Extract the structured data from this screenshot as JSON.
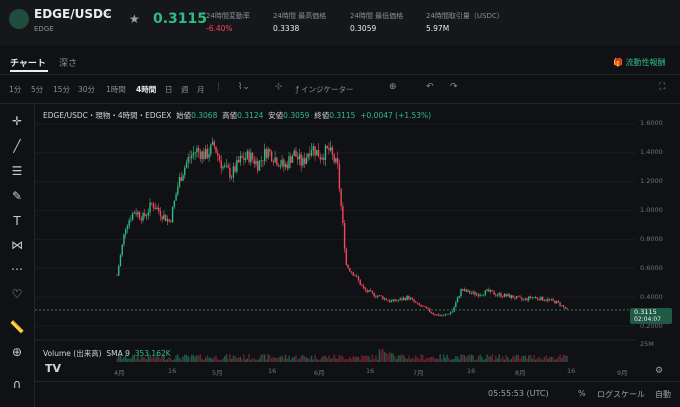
{
  "header": {
    "pair": "EDGE/USDC",
    "sub": "EDGE",
    "price": "0.3115",
    "stats": [
      {
        "label": "24時間変動率",
        "value": "-6.40%"
      },
      {
        "label": "24時間 最高価格",
        "value": "0.3338"
      },
      {
        "label": "24時間 最低価格",
        "value": "0.3059"
      },
      {
        "label": "24時間取引量（USDC）",
        "value": "5.97M"
      }
    ]
  },
  "tabs": {
    "chart": "チャート",
    "depth": "深さ",
    "liquidity": "流動性報酬"
  },
  "toolbar": {
    "timeframes": [
      "1分",
      "5分",
      "15分",
      "30分",
      "1時間",
      "4時間",
      "日",
      "週",
      "月"
    ],
    "active_timeframe": "4時間",
    "indicators": "インジケーター"
  },
  "legend": {
    "title": "EDGE/USDC・現物・4時間・EDGEX",
    "open_label": "始値",
    "open": "0.3068",
    "high_label": "高値",
    "high": "0.3124",
    "low_label": "安値",
    "low": "0.3059",
    "close_label": "終値",
    "close": "0.3115",
    "change": "+0.0047 (+1.53%)"
  },
  "volume_legend": {
    "label": "Volume (出来高)",
    "sma": "SMA 9",
    "value": "353.162K"
  },
  "price_tag": {
    "price": "0.3115",
    "countdown": "02:04:07"
  },
  "bottom": {
    "time": "05:55:53 (UTC)",
    "pct": "%",
    "log": "ログスケール",
    "auto": "自動"
  },
  "colors": {
    "up": "#2ebd85",
    "down": "#f6465d",
    "bg": "#101114"
  },
  "chart_data": {
    "type": "candlestick",
    "y_ticks": [
      "1.6000",
      "1.4000",
      "1.2000",
      "1.0000",
      "0.8000",
      "0.6000",
      "0.4000",
      "0.2000"
    ],
    "volume_tick": "25M",
    "x_ticks": [
      "4月",
      "16",
      "5月",
      "16",
      "6月",
      "16",
      "7月",
      "16",
      "8月",
      "16",
      "9月"
    ],
    "close_path": [
      [
        0,
        0.55
      ],
      [
        1,
        0.9
      ],
      [
        2,
        1.0
      ],
      [
        3,
        0.95
      ],
      [
        4,
        1.05
      ],
      [
        5,
        0.98
      ],
      [
        6,
        0.92
      ],
      [
        7,
        1.2
      ],
      [
        8,
        1.35
      ],
      [
        9,
        1.42
      ],
      [
        10,
        1.38
      ],
      [
        11,
        1.45
      ],
      [
        12,
        1.3
      ],
      [
        13,
        1.25
      ],
      [
        14,
        1.35
      ],
      [
        15,
        1.38
      ],
      [
        16,
        1.32
      ],
      [
        17,
        1.42
      ],
      [
        18,
        1.36
      ],
      [
        19,
        1.3
      ],
      [
        20,
        1.4
      ],
      [
        21,
        1.32
      ],
      [
        22,
        1.45
      ],
      [
        23,
        1.38
      ],
      [
        24,
        1.42
      ],
      [
        25,
        1.3
      ],
      [
        26,
        0.62
      ],
      [
        27,
        0.55
      ],
      [
        28,
        0.45
      ],
      [
        29,
        0.42
      ],
      [
        30,
        0.4
      ],
      [
        31,
        0.37
      ],
      [
        32,
        0.38
      ],
      [
        33,
        0.4
      ],
      [
        34,
        0.35
      ],
      [
        35,
        0.32
      ],
      [
        36,
        0.28
      ],
      [
        37,
        0.27
      ],
      [
        38,
        0.3
      ],
      [
        39,
        0.45
      ],
      [
        40,
        0.43
      ],
      [
        41,
        0.42
      ],
      [
        42,
        0.44
      ],
      [
        43,
        0.42
      ],
      [
        44,
        0.41
      ],
      [
        45,
        0.4
      ],
      [
        46,
        0.38
      ],
      [
        47,
        0.4
      ],
      [
        48,
        0.39
      ],
      [
        49,
        0.38
      ],
      [
        50,
        0.36
      ],
      [
        51,
        0.3115
      ]
    ]
  }
}
